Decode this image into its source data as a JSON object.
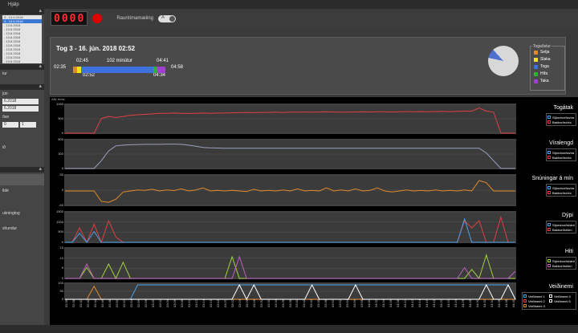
{
  "menu": {
    "items": [
      "",
      "Hjálp"
    ]
  },
  "toolbar": {
    "counter_digits": [
      "0",
      "0",
      "0",
      "0"
    ],
    "realtime_label": "Rauntímamæling",
    "toggle_text": "A"
  },
  "sidebar": {
    "trip_list": [
      "3 - 13.6.2018",
      "4 - 13.6.2018",
      "- 13.6.2018",
      "- 13.6.2018",
      "- 13.6.2018",
      "- 13.6.2018",
      "- 13.6.2018",
      "- 13.6.2018",
      "- 13.6.2018",
      "- 13.6.2018",
      "- 13.6.2018",
      "- 13.6.2018"
    ],
    "selected_index": 1,
    "labels": [
      "tur",
      "jún",
      "ðan",
      "ið",
      "lblé",
      "ukningtog",
      "shundur"
    ],
    "date_inputs": [
      "6.2018",
      "6.2018"
    ],
    "small_inputs": [
      "0",
      "1"
    ]
  },
  "trip": {
    "title": "Tog 3 - 16. jún. 2018 02:52",
    "times": {
      "t1": "02:35",
      "t2": "02:45",
      "t3": "02:52",
      "duration": "102 mínútur",
      "t4": "04:41",
      "t5": "04:34",
      "t6": "04:58"
    }
  },
  "trip_legend": {
    "title": "Togaðstur",
    "items": [
      {
        "label": "Setja",
        "color": "#e08a2a"
      },
      {
        "label": "Slaka",
        "color": "#f0e020"
      },
      {
        "label": "Toga",
        "color": "#4070e0"
      },
      {
        "label": "Hífa",
        "color": "#30b030"
      },
      {
        "label": "Taka",
        "color": "#a040d0"
      }
    ]
  },
  "graphs": {
    "panel_title": "Allir ferlar",
    "x_ticks": [
      "02:35",
      "02:38",
      "02:40",
      "02:42",
      "02:44",
      "02:46",
      "02:48",
      "02:50",
      "02:52",
      "02:54",
      "02:56",
      "02:58",
      "03:00",
      "03:02",
      "03:04",
      "03:06",
      "03:08",
      "03:10",
      "03:12",
      "03:14",
      "03:16",
      "03:18",
      "03:20",
      "03:22",
      "03:24",
      "03:26",
      "03:28",
      "03:30",
      "03:32",
      "03:34",
      "03:36",
      "03:38",
      "03:40",
      "03:42",
      "03:44",
      "03:46",
      "03:48",
      "03:50",
      "03:52",
      "03:54",
      "03:56",
      "03:58",
      "04:00",
      "04:02",
      "04:04",
      "04:06",
      "04:08",
      "04:10",
      "04:12",
      "04:14",
      "04:16",
      "04:18",
      "04:20",
      "04:22",
      "04:24",
      "04:26",
      "04:28",
      "04:30",
      "04:32",
      "04:34",
      "04:36",
      "04:38",
      "04:40"
    ],
    "charts": [
      {
        "title": "Togátak",
        "yticks": [
          "1000",
          "500",
          "0"
        ],
        "legend": [
          {
            "label": "Stjórnborðsvíra",
            "color": "#4aa0e8"
          },
          {
            "label": "Bakborðsvíra",
            "color": "#e04040"
          }
        ]
      },
      {
        "title": "Víralengd",
        "yticks": [
          "600",
          "300",
          "0"
        ],
        "legend": [
          {
            "label": "Stjórnborðsvíra",
            "color": "#4aa0e8"
          },
          {
            "label": "Bakborðsvíra",
            "color": "#e04040"
          }
        ]
      },
      {
        "title": "Snúningar á mín",
        "yticks": [
          "50",
          "0",
          "-50"
        ],
        "legend": [
          {
            "label": "Stjórnborðsvíra",
            "color": "#4aa0e8"
          },
          {
            "label": "Bakborðsvíra",
            "color": "#e04040"
          }
        ]
      },
      {
        "title": "Dýpi",
        "yticks": [
          "1500",
          "1000",
          "500",
          "0"
        ],
        "legend": [
          {
            "label": "Stjórnborðshleri",
            "color": "#4aa0e8"
          },
          {
            "label": "Bakborðshleri",
            "color": "#e04040"
          }
        ]
      },
      {
        "title": "Hiti",
        "yticks": [
          "15",
          "10",
          "5",
          "0"
        ],
        "legend": [
          {
            "label": "Stjórnborðshleri",
            "color": "#a0d040"
          },
          {
            "label": "Bakborðshleri",
            "color": "#c060c0"
          }
        ]
      },
      {
        "title": "Veiðinemi",
        "yticks": [
          "100",
          "50",
          "0"
        ],
        "legend": [
          {
            "label": "Veiðinemi 1",
            "color": "#4aa0e8"
          },
          {
            "label": "Veiðinemi 4",
            "color": "#ffffff"
          },
          {
            "label": "Veiðinemi 2",
            "color": "#e04040"
          },
          {
            "label": "Veiðinemi 5",
            "color": "#ffffff"
          },
          {
            "label": "Veiðinemi 3",
            "color": "#e08a2a"
          }
        ]
      }
    ]
  },
  "chart_data": {
    "type": "line",
    "x": [
      "02:35",
      "02:38",
      "02:40",
      "02:42",
      "02:44",
      "02:46",
      "02:48",
      "02:50",
      "02:52",
      "02:54",
      "02:56",
      "02:58",
      "03:00",
      "03:02",
      "03:04",
      "03:06",
      "03:08",
      "03:10",
      "03:12",
      "03:14",
      "03:16",
      "03:18",
      "03:20",
      "03:22",
      "03:24",
      "03:26",
      "03:28",
      "03:30",
      "03:32",
      "03:34",
      "03:36",
      "03:38",
      "03:40",
      "03:42",
      "03:44",
      "03:46",
      "03:48",
      "03:50",
      "03:52",
      "03:54",
      "03:56",
      "03:58",
      "04:00",
      "04:02",
      "04:04",
      "04:06",
      "04:08",
      "04:10",
      "04:12",
      "04:14",
      "04:16",
      "04:18",
      "04:20",
      "04:22",
      "04:24",
      "04:26",
      "04:28",
      "04:30",
      "04:32",
      "04:34",
      "04:36",
      "04:38",
      "04:40"
    ],
    "panels": [
      {
        "title": "Togátak",
        "ylim": [
          0,
          1300
        ],
        "series": [
          {
            "name": "Bakborðsvíra",
            "color": "#e04040",
            "values": [
              0,
              0,
              0,
              0,
              0,
              700,
              800,
              750,
              800,
              850,
              880,
              900,
              920,
              950,
              950,
              960,
              950,
              940,
              950,
              960,
              950,
              960,
              960,
              970,
              980,
              990,
              980,
              990,
              990,
              1000,
              990,
              1000,
              1000,
              1010,
              1000,
              1010,
              1020,
              1010,
              1000,
              1010,
              1010,
              1020,
              1010,
              1020,
              1020,
              1010,
              1020,
              1030,
              1020,
              1030,
              1020,
              1030,
              1040,
              1030,
              1040,
              1050,
              1050,
              1200,
              1050,
              1000,
              0,
              0,
              0
            ]
          }
        ]
      },
      {
        "title": "Víralengd",
        "ylim": [
          0,
          700
        ],
        "series": [
          {
            "name": "Stjórnborðsvíra",
            "color": "#9aa0c0",
            "values": [
              0,
              0,
              0,
              0,
              0,
              200,
              450,
              580,
              600,
              610,
              615,
              620,
              620,
              620,
              625,
              625,
              620,
              600,
              570,
              540,
              530,
              525,
              520,
              520,
              520,
              520,
              520,
              520,
              520,
              520,
              520,
              520,
              520,
              520,
              520,
              520,
              520,
              520,
              520,
              520,
              520,
              520,
              520,
              520,
              520,
              520,
              520,
              520,
              520,
              520,
              520,
              520,
              520,
              520,
              520,
              520,
              520,
              520,
              400,
              200,
              0,
              0,
              0
            ]
          }
        ]
      },
      {
        "title": "Snúningar á mín",
        "ylim": [
          -70,
          70
        ],
        "series": [
          {
            "name": "Bakborðsvíra",
            "color": "#e08a2a",
            "values": [
              0,
              0,
              0,
              0,
              0,
              -50,
              -55,
              -40,
              -5,
              0,
              5,
              3,
              8,
              0,
              5,
              2,
              10,
              0,
              5,
              15,
              0,
              3,
              0,
              3,
              0,
              -3,
              8,
              0,
              3,
              0,
              5,
              0,
              10,
              0,
              3,
              0,
              15,
              0,
              5,
              0,
              10,
              0,
              3,
              15,
              0,
              -5,
              0,
              5,
              0,
              3,
              0,
              5,
              0,
              3,
              0,
              5,
              0,
              50,
              40,
              0,
              0,
              0,
              0
            ]
          }
        ]
      },
      {
        "title": "Dýpi",
        "ylim": [
          0,
          1600
        ],
        "series": [
          {
            "name": "Bakborðshleri",
            "color": "#e04040",
            "values": [
              0,
              0,
              800,
              0,
              1000,
              0,
              1200,
              300,
              0,
              0,
              0,
              0,
              0,
              0,
              0,
              0,
              0,
              0,
              0,
              0,
              0,
              0,
              0,
              0,
              0,
              0,
              0,
              0,
              0,
              0,
              0,
              0,
              0,
              0,
              0,
              0,
              0,
              0,
              0,
              0,
              0,
              0,
              0,
              0,
              0,
              0,
              0,
              0,
              0,
              0,
              0,
              0,
              0,
              0,
              0,
              1200,
              800,
              1200,
              0,
              0,
              1400,
              0,
              0
            ]
          },
          {
            "name": "Stjórnborðshleri",
            "color": "#4aa0e8",
            "values": [
              0,
              0,
              500,
              0,
              600,
              0,
              0,
              0,
              0,
              0,
              0,
              0,
              0,
              0,
              0,
              0,
              0,
              0,
              0,
              0,
              0,
              0,
              0,
              0,
              0,
              0,
              0,
              0,
              0,
              0,
              0,
              0,
              0,
              0,
              0,
              0,
              0,
              0,
              0,
              0,
              0,
              0,
              0,
              0,
              0,
              0,
              0,
              0,
              0,
              0,
              0,
              0,
              0,
              0,
              0,
              1300,
              0,
              0,
              0,
              0,
              0,
              0,
              0
            ]
          }
        ]
      },
      {
        "title": "Hiti",
        "ylim": [
          0,
          16
        ],
        "series": [
          {
            "name": "Stjórnborðshleri",
            "color": "#a0d040",
            "values": [
              0,
              0,
              0,
              6,
              0,
              0,
              8,
              0,
              9,
              0,
              0,
              0,
              0,
              0,
              0,
              0,
              0,
              0,
              0,
              0,
              0,
              0,
              0,
              12,
              0,
              0,
              0,
              0,
              0,
              0,
              0,
              0,
              0,
              0,
              0,
              0,
              0,
              0,
              0,
              0,
              0,
              0,
              0,
              0,
              0,
              0,
              0,
              0,
              0,
              0,
              0,
              0,
              0,
              0,
              0,
              0,
              5,
              0,
              13,
              0,
              0,
              0,
              0
            ]
          },
          {
            "name": "Bakborðshleri",
            "color": "#c060c0",
            "values": [
              0,
              0,
              0,
              8,
              0,
              0,
              0,
              0,
              0,
              0,
              0,
              0,
              0,
              0,
              0,
              0,
              0,
              0,
              0,
              0,
              0,
              0,
              0,
              0,
              12,
              0,
              0,
              0,
              0,
              0,
              0,
              0,
              0,
              0,
              0,
              0,
              0,
              0,
              0,
              0,
              0,
              0,
              0,
              0,
              0,
              0,
              0,
              0,
              0,
              0,
              0,
              0,
              0,
              0,
              0,
              6,
              0,
              0,
              0,
              0,
              0,
              0,
              4
            ]
          }
        ]
      },
      {
        "title": "Veiðinemi",
        "ylim": [
          0,
          100
        ],
        "series": [
          {
            "name": "Veiðinemi 1",
            "color": "#4aa0e8",
            "values": [
              0,
              0,
              0,
              0,
              0,
              0,
              0,
              0,
              0,
              0,
              100,
              100,
              100,
              100,
              100,
              100,
              100,
              100,
              100,
              100,
              100,
              100,
              100,
              100,
              100,
              100,
              100,
              100,
              100,
              100,
              100,
              100,
              100,
              100,
              100,
              100,
              100,
              100,
              100,
              100,
              100,
              100,
              100,
              100,
              100,
              100,
              100,
              100,
              100,
              100,
              100,
              100,
              100,
              100,
              100,
              100,
              100,
              100,
              100,
              100,
              100,
              100,
              0
            ]
          },
          {
            "name": "Veiðinemi 3",
            "color": "#e08a2a",
            "values": [
              0,
              0,
              0,
              0,
              90,
              0,
              0,
              0,
              0,
              0,
              0,
              0,
              0,
              0,
              0,
              0,
              0,
              0,
              0,
              0,
              0,
              0,
              0,
              0,
              0,
              0,
              0,
              0,
              0,
              0,
              0,
              0,
              0,
              0,
              0,
              0,
              0,
              0,
              0,
              0,
              0,
              0,
              0,
              0,
              0,
              0,
              0,
              0,
              0,
              0,
              0,
              0,
              0,
              0,
              0,
              0,
              0,
              0,
              0,
              0,
              0,
              0,
              0
            ]
          },
          {
            "name": "Veiðinemi 4",
            "color": "#ffffff",
            "values": [
              0,
              0,
              0,
              0,
              0,
              0,
              0,
              0,
              0,
              0,
              0,
              0,
              0,
              0,
              0,
              0,
              0,
              0,
              0,
              0,
              0,
              0,
              0,
              0,
              100,
              0,
              100,
              0,
              0,
              0,
              0,
              0,
              0,
              0,
              100,
              0,
              0,
              0,
              0,
              0,
              100,
              0,
              0,
              0,
              0,
              0,
              0,
              0,
              0,
              0,
              0,
              0,
              0,
              0,
              0,
              0,
              0,
              0,
              100,
              0,
              0,
              100,
              0
            ]
          }
        ]
      }
    ]
  }
}
